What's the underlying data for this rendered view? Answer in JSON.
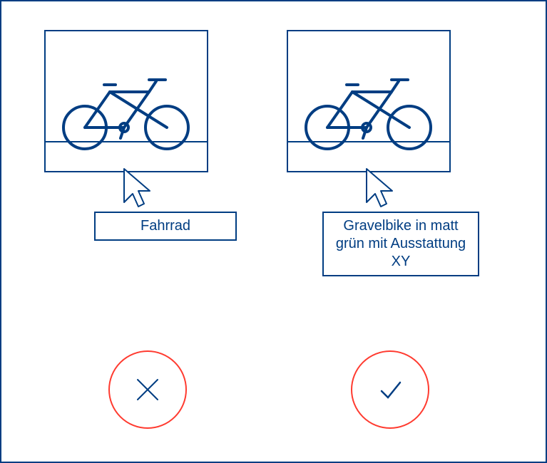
{
  "examples": {
    "bad": {
      "tooltip": "Fahrrad",
      "status": "incorrect"
    },
    "good": {
      "tooltip": "Gravelbike in matt grün mit Ausstattung XY",
      "status": "correct"
    }
  },
  "colors": {
    "stroke": "#003d82",
    "error": "#ff3b30"
  }
}
